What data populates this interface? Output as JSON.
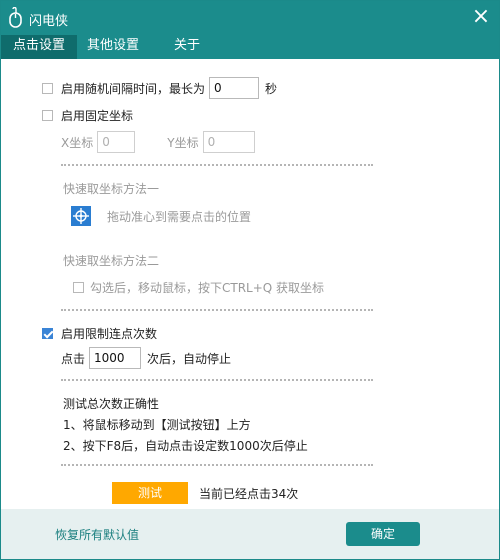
{
  "window": {
    "title": "闪电侠",
    "close_glyph": "×",
    "icon": "mouse-icon"
  },
  "tabs": [
    {
      "label": "点击设置",
      "active": true
    },
    {
      "label": "其他设置",
      "active": false
    },
    {
      "label": "关于",
      "active": false
    }
  ],
  "random_interval": {
    "checked": false,
    "label": "启用随机间隔时间，最长为",
    "value": "0",
    "unit": "秒"
  },
  "fixed_coords": {
    "checked": false,
    "label": "启用固定坐标",
    "x_label": "X坐标",
    "x_value": "0",
    "y_label": "Y坐标",
    "y_value": "0"
  },
  "method1": {
    "title": "快速取坐标方法一",
    "hint": "拖动准心到需要点击的位置"
  },
  "method2": {
    "title": "快速取坐标方法二",
    "checked": false,
    "label": "勾选后，移动鼠标，按下CTRL+Q 获取坐标"
  },
  "limit_clicks": {
    "checked": true,
    "label": "启用限制连点次数",
    "prefix": "点击",
    "value": "1000",
    "suffix": "次后，自动停止"
  },
  "test_section": {
    "title": "测试总次数正确性",
    "step1": "1、将鼠标移动到【测试按钮】上方",
    "step2": "2、按下F8后，自动点击设定数1000次后停止",
    "button": "测试",
    "status": "当前已经点击34次"
  },
  "footer": {
    "reset": "恢复所有默认值",
    "ok": "确定"
  },
  "colors": {
    "teal": "#1b8c8c",
    "test_orange": "#ffa800",
    "checkbox_blue": "#3a84d6"
  }
}
